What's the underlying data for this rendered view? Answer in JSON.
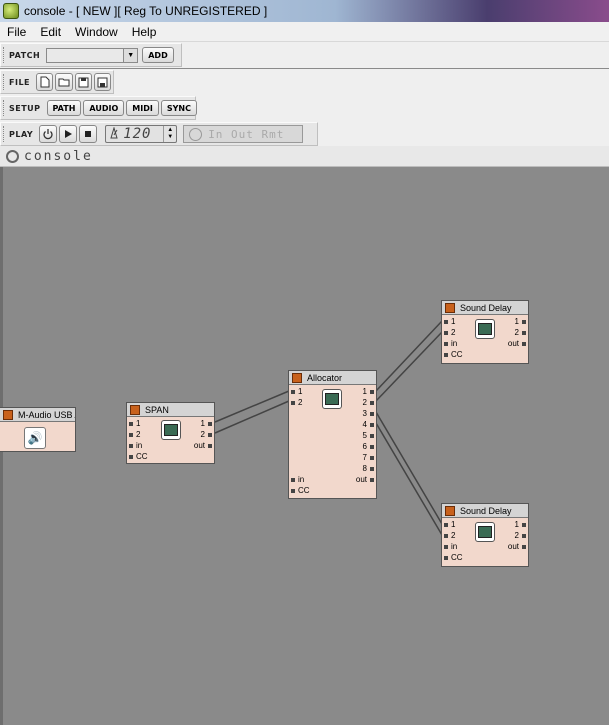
{
  "window": {
    "title": "console - [ NEW ][ Reg To UNREGISTERED ]"
  },
  "menubar": {
    "items": [
      "File",
      "Edit",
      "Window",
      "Help"
    ]
  },
  "toolbars": {
    "patch": {
      "label": "PATCH",
      "add_label": "ADD",
      "selected_patch": ""
    },
    "file": {
      "label": "FILE",
      "icons": [
        "new-file-icon",
        "open-folder-icon",
        "save-icon",
        "save-as-icon"
      ]
    },
    "setup": {
      "label": "SETUP",
      "buttons": [
        "PATH",
        "AUDIO",
        "MIDI",
        "SYNC"
      ]
    },
    "play": {
      "label": "PLAY",
      "tempo": "120",
      "remote_text": "In Out Rmt"
    }
  },
  "console_header": {
    "text": "console"
  },
  "modules": [
    {
      "id": "maudio",
      "title": "M-Audio USB A",
      "inputs": [],
      "outputs": []
    },
    {
      "id": "span",
      "title": "SPAN",
      "inputs": [
        "1",
        "2",
        "in",
        "CC"
      ],
      "outputs": [
        "1",
        "2",
        "out"
      ]
    },
    {
      "id": "allocator",
      "title": "Allocator",
      "inputs": [
        "1",
        "2",
        "in",
        "CC"
      ],
      "outputs": [
        "1",
        "2",
        "3",
        "4",
        "5",
        "6",
        "7",
        "8",
        "out"
      ]
    },
    {
      "id": "delay1",
      "title": "Sound Delay",
      "inputs": [
        "1",
        "2",
        "in",
        "CC"
      ],
      "outputs": [
        "1",
        "2",
        "out"
      ]
    },
    {
      "id": "delay2",
      "title": "Sound Delay",
      "inputs": [
        "1",
        "2",
        "in",
        "CC"
      ],
      "outputs": [
        "1",
        "2",
        "out"
      ]
    }
  ],
  "colors": {
    "module_body": "#f2d8cc",
    "module_header": "#d4d4d4",
    "module_marker": "#c8611c",
    "canvas": "#8a8a8a"
  }
}
